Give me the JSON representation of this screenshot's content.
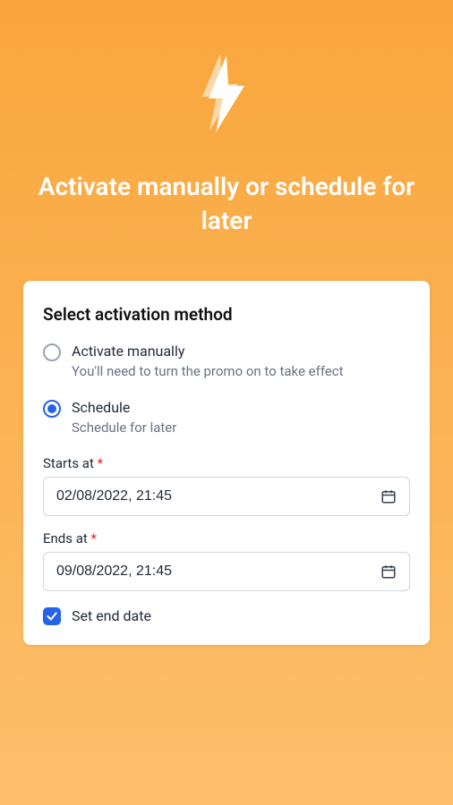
{
  "hero": {
    "title": "Activate manually or schedule for later"
  },
  "card": {
    "title": "Select activation method",
    "options": [
      {
        "label": "Activate manually",
        "desc": "You'll need to turn the promo on to take effect"
      },
      {
        "label": "Schedule",
        "desc": "Schedule for later"
      }
    ],
    "starts_at": {
      "label": "Starts at",
      "required": "*",
      "value": "02/08/2022, 21:45"
    },
    "ends_at": {
      "label": "Ends at",
      "required": "*",
      "value": "09/08/2022, 21:45"
    },
    "set_end_date": {
      "label": "Set end date",
      "checked": true
    }
  }
}
